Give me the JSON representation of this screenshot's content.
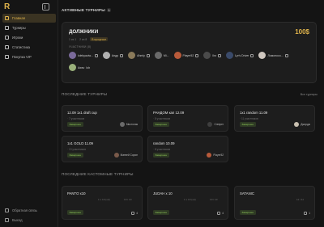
{
  "app": {
    "logo": "R"
  },
  "sidebar": {
    "items": [
      {
        "label": "Главная",
        "icon": "home-icon"
      },
      {
        "label": "Турниры",
        "icon": "trophy-icon"
      },
      {
        "label": "Игроки",
        "icon": "users-icon"
      },
      {
        "label": "Статистика",
        "icon": "chart-icon"
      },
      {
        "label": "Покупка VIP",
        "icon": "crown-icon"
      }
    ],
    "bottom": [
      {
        "label": "Обратная связь",
        "icon": "message-icon"
      },
      {
        "label": "Выход",
        "icon": "logout-icon"
      }
    ]
  },
  "active": {
    "title": "АКТИВНЫЕ ТУРНИРЫ",
    "count": "1",
    "featured": {
      "title": "ДОЛЖНИКИ",
      "prize": "100$",
      "meta_left": "1 из 1",
      "meta_mid": "2 из 8",
      "tag": "В процессе",
      "players_label": "УЧАСТНИКИ (8)",
      "players": [
        {
          "name": "lolekyauiw..."
        },
        {
          "name": "Андр"
        },
        {
          "name": "Ahmly"
        },
        {
          "name": "Mi..."
        },
        {
          "name": "Player52"
        },
        {
          "name": "Ilsr"
        },
        {
          "name": "Lyr's Driver"
        },
        {
          "name": "Ломоносо..."
        },
        {
          "name": "Awsv"
        },
        {
          "name": "Iob"
        }
      ]
    }
  },
  "recent": {
    "title": "ПОСЛЕДНИЕ ТУРНИРЫ",
    "all_link": "Все турниры",
    "cards": [
      {
        "title": "12.09 1x1 draft cup",
        "sub": "· 7 участников",
        "badge": "Завершен",
        "user": "Мистолак"
      },
      {
        "title": "РАНДОМ кап 12.09",
        "sub": "· 8 участников",
        "badge": "Завершен",
        "user": "Creeper"
      },
      {
        "title": "1x1 random 11.09",
        "sub": "· 11 участников",
        "badge": "Завершен",
        "user": "Джордж"
      },
      {
        "title": "1x1 GOLD 11.09",
        "sub": "· 13 участников",
        "badge": "Завершен",
        "user": "Матвей Сорин"
      },
      {
        "title": "random 10.09",
        "sub": "· 8 участников",
        "badge": "Завершен",
        "user": "Player52"
      }
    ]
  },
  "custom": {
    "title": "ПОСЛЕДНИЕ КАСТОМНЫЕ ТУРНИРЫ",
    "cards": [
      {
        "title": "PANTO x10",
        "col1": "1 x 10 (x2)",
        "col2": "10 / 10",
        "badge": "Завершен",
        "count": "4"
      },
      {
        "title": "JUDAH x 10",
        "col1": "1 x 10 (x2)",
        "col2": "10 / 10",
        "badge": "Завершен",
        "count": "4"
      },
      {
        "title": "SATANIC",
        "col1": "",
        "col2": "11 / 11",
        "badge": "Завершен",
        "count": "1"
      }
    ]
  }
}
